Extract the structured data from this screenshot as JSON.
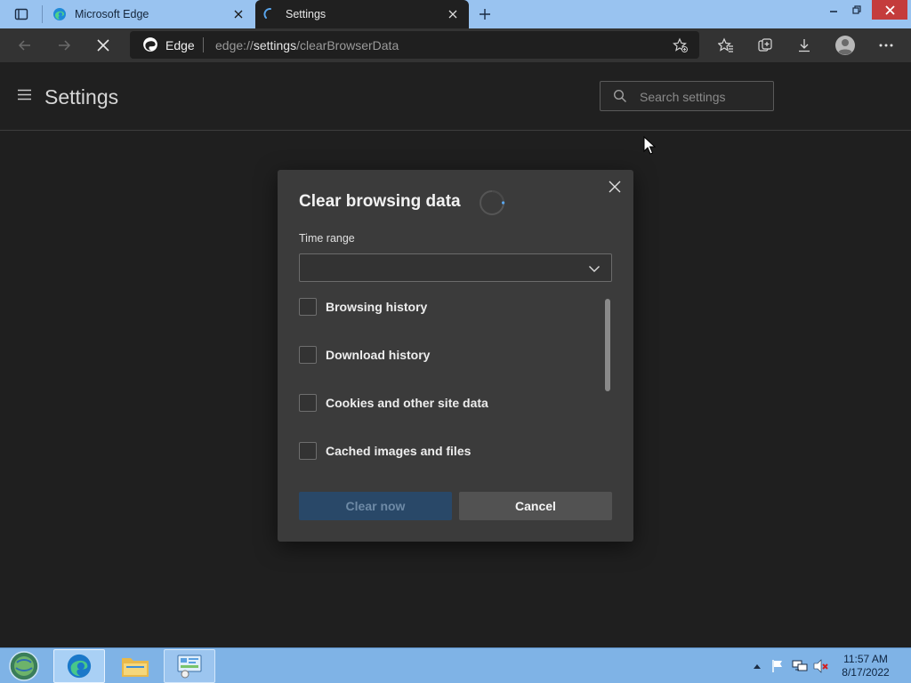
{
  "browser": {
    "tabs": [
      {
        "title": "Microsoft Edge",
        "active": false
      },
      {
        "title": "Settings",
        "active": true
      }
    ],
    "omnibox": {
      "brand": "Edge",
      "url_scheme": "edge://",
      "url_host": "settings",
      "url_path": "/clearBrowserData"
    }
  },
  "settings": {
    "title": "Settings",
    "search_placeholder": "Search settings"
  },
  "dialog": {
    "title": "Clear browsing data",
    "time_range_label": "Time range",
    "time_range_value": "",
    "options": [
      {
        "label": "Browsing history",
        "checked": false
      },
      {
        "label": "Download history",
        "checked": false
      },
      {
        "label": "Cookies and other site data",
        "checked": false
      },
      {
        "label": "Cached images and files",
        "checked": false
      }
    ],
    "clear_button": "Clear now",
    "cancel_button": "Cancel"
  },
  "taskbar": {
    "time": "11:57 AM",
    "date": "8/17/2022"
  },
  "colors": {
    "tabstrip": "#99c3f0",
    "page_bg": "#202020",
    "dialog_bg": "#3b3b3b",
    "clear_button_bg": "#294868",
    "taskbar": "#7fb3e6"
  },
  "icons": [
    "tab-actions-icon",
    "edge-logo-icon",
    "loading-icon",
    "close-icon",
    "plus-icon",
    "minimize-icon",
    "restore-icon",
    "back-icon",
    "forward-icon",
    "stop-icon",
    "favorite-add-icon",
    "favorites-icon",
    "collections-icon",
    "download-icon",
    "profile-icon",
    "more-icon",
    "hamburger-icon",
    "search-icon",
    "spinner-icon",
    "chevron-down-icon",
    "start-orb-icon",
    "folder-icon",
    "control-panel-icon",
    "tray-up-icon",
    "flag-icon",
    "network-icon",
    "volume-muted-icon"
  ]
}
